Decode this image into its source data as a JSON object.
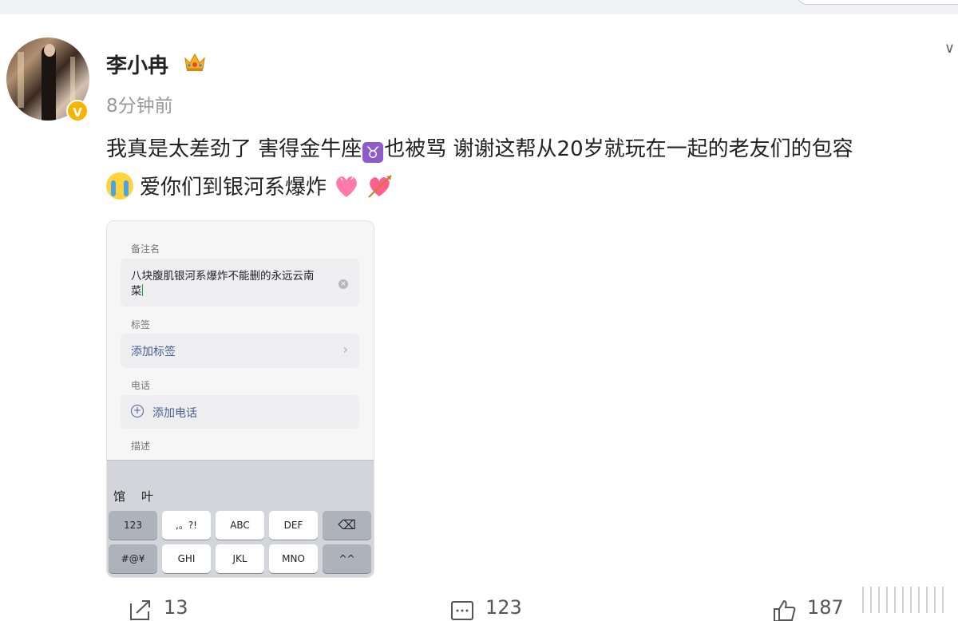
{
  "post": {
    "username": "李小冉",
    "timestamp": "8分钟前",
    "text_line1_a": "我真是太差劲了 害得金牛座",
    "taurus_symbol": "♉",
    "text_line1_b": "也被骂 谢谢这帮从20岁就玩在一起的老友们的包容",
    "text_line2": "爱你们到银河系爆炸",
    "verified_badge": "V",
    "icons": [
      "crown-icon",
      "taurus-emoji",
      "crying-emoji",
      "heart-emoji",
      "heart-arrow-emoji"
    ]
  },
  "screenshot": {
    "remark_label": "备注名",
    "remark_value": "八块腹肌银河系爆炸不能删的永远云南菜",
    "tag_label": "标签",
    "tag_action": "添加标签",
    "phone_label": "电话",
    "phone_action": "添加电话",
    "desc_label": "描述",
    "candidates": [
      "馆",
      "叶"
    ],
    "keys_row1": [
      "123",
      ",。?!",
      "ABC",
      "DEF",
      "⌫"
    ],
    "keys_row2": [
      "#@¥",
      "GHI",
      "JKL",
      "MNO",
      "^^"
    ]
  },
  "actions": {
    "repost_count": "13",
    "comment_count": "123",
    "like_count": "187"
  },
  "colors": {
    "verified": "#f7b500",
    "taurus_bg": "#8e5cc9",
    "link_blue": "#4a5f8e"
  }
}
